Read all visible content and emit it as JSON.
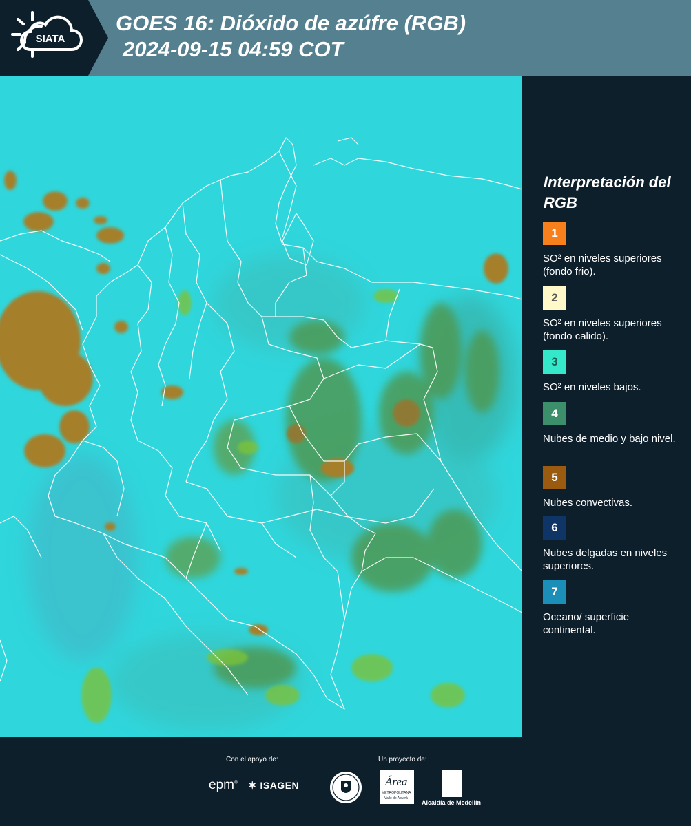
{
  "header": {
    "logo_text": "SIATA",
    "title_line1": "GOES 16: Dióxido de azúfre (RGB)",
    "title_line2": "2024-09-15 04:59 COT"
  },
  "legend": {
    "title": "Interpretación del RGB",
    "items": [
      {
        "number": "1",
        "color": "#f7801c",
        "number_color": "#ffffff",
        "text": "SO² en niveles superiores (fondo frio)."
      },
      {
        "number": "2",
        "color": "#fff8c9",
        "number_color": "#555555",
        "text": "SO² en niveles superiores (fondo calido)."
      },
      {
        "number": "3",
        "color": "#34e8c9",
        "number_color": "#1b5e55",
        "text": "SO² en niveles bajos."
      },
      {
        "number": "4",
        "color": "#3b8f6a",
        "number_color": "#ffffff",
        "text": "Nubes de medio y bajo nivel."
      },
      {
        "number": "5",
        "color": "#9a5a10",
        "number_color": "#ffffff",
        "text": "Nubes convectivas."
      },
      {
        "number": "6",
        "color": "#0f3566",
        "number_color": "#ffffff",
        "text": "Nubes delgadas en niveles superiores."
      },
      {
        "number": "7",
        "color": "#1b8fb8",
        "number_color": "#ffffff",
        "text": "Oceano/ superficie continental."
      }
    ]
  },
  "footer": {
    "support_caption": "Con el apoyo de:",
    "project_caption": "Un proyecto de:",
    "sponsors": {
      "epm": "epm",
      "isagen": "ISAGEN",
      "area_metro_name": "Área",
      "area_metro_sub": "METROPOLITANA",
      "area_metro_sub2": "Valle de Aburrá",
      "alcaldia": "Alcaldía de Medellín"
    }
  },
  "map": {
    "colors": {
      "background": "#2fd6dc",
      "convective": "#a57f2a",
      "mid_low_cloud": "#4e9a55",
      "green_patch": "#7cc23a",
      "borders": "#ffffff"
    }
  }
}
